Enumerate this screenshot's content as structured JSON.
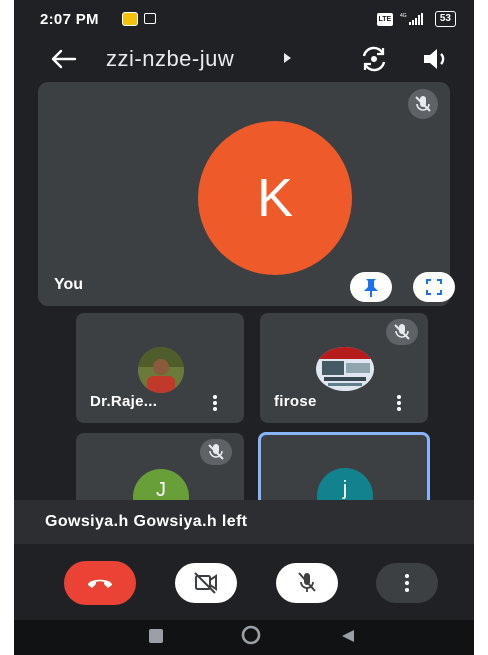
{
  "status_bar": {
    "time": "2:07 PM",
    "network_label": "4G",
    "battery": "53"
  },
  "top_bar": {
    "meeting_code": "zzi-nzbe-juw"
  },
  "self_tile": {
    "avatar_letter": "K",
    "label": "You",
    "avatar_color": "#ee5a2a",
    "mic": "muted"
  },
  "participants": [
    {
      "name": "Dr.Raje...",
      "kind": "photo",
      "mic": "on"
    },
    {
      "name": "firose",
      "kind": "photo",
      "mic": "muted"
    },
    {
      "name": "",
      "avatar_letter": "J",
      "avatar_color": "#689f38",
      "mic": "muted"
    },
    {
      "name": "",
      "avatar_letter": "j",
      "avatar_color": "#12828e",
      "mic": "on",
      "active_speaker": true
    }
  ],
  "toast": {
    "text": "Gowsiya.h Gowsiya.h left"
  },
  "controls": {
    "end_call": "end-call-icon",
    "camera": "camera-off-icon",
    "microphone": "mic-off-icon",
    "more": "more-vert-icon",
    "end_call_color": "#ea4335"
  },
  "colors": {
    "background": "#202124",
    "tile": "#3c4043",
    "active_border": "#8ab4f8"
  }
}
